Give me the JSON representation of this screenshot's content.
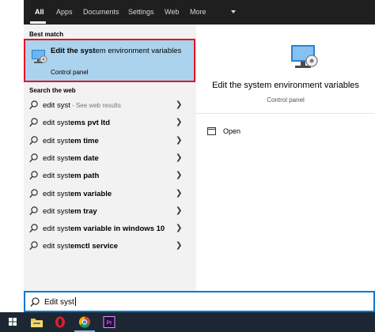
{
  "tabs": [
    {
      "label": "All",
      "active": true
    },
    {
      "label": "Apps"
    },
    {
      "label": "Documents"
    },
    {
      "label": "Settings"
    },
    {
      "label": "Web"
    },
    {
      "label": "More"
    }
  ],
  "best_match": {
    "header": "Best match",
    "title_bold": "Edit the syst",
    "title_rest": "em environment variables",
    "subtitle": "Control panel"
  },
  "web": {
    "header": "Search the web",
    "items": [
      {
        "query": "edit syst",
        "bold": "",
        "hint": " - See web results"
      },
      {
        "query": "edit syst",
        "bold": "ems pvt ltd",
        "hint": ""
      },
      {
        "query": "edit syst",
        "bold": "em time",
        "hint": ""
      },
      {
        "query": "edit syst",
        "bold": "em date",
        "hint": ""
      },
      {
        "query": "edit syst",
        "bold": "em path",
        "hint": ""
      },
      {
        "query": "edit syst",
        "bold": "em variable",
        "hint": ""
      },
      {
        "query": "edit syst",
        "bold": "em tray",
        "hint": ""
      },
      {
        "query": "edit syst",
        "bold": "em variable in windows 10",
        "hint": ""
      },
      {
        "query": "edit syst",
        "bold": "emctl service",
        "hint": ""
      }
    ]
  },
  "detail": {
    "title": "Edit the system environment variables",
    "subtitle": "Control panel",
    "open_label": "Open"
  },
  "search": {
    "value": "Edit syst"
  },
  "taskbar": {
    "apps": [
      "windows-start",
      "file-explorer",
      "opera",
      "chrome",
      "premiere-pro"
    ]
  },
  "colors": {
    "accent": "#0078d7",
    "highlight": "#abd3ee",
    "outline": "#e81123",
    "topbar": "#1f1f1f",
    "taskbar": "#1c2733"
  }
}
